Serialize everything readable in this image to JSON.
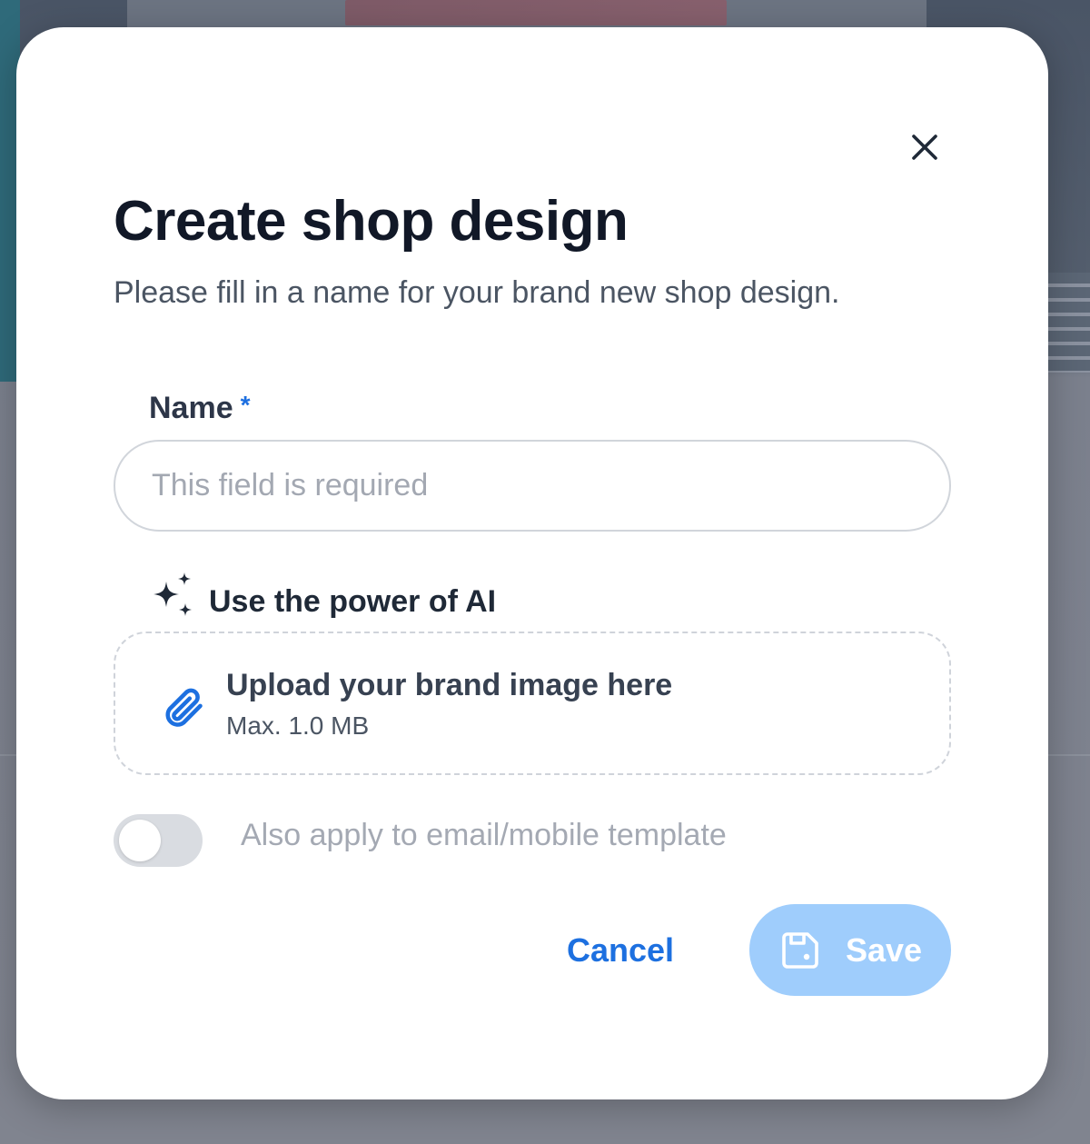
{
  "modal": {
    "title": "Create shop design",
    "subtitle": "Please fill in a name for your brand new shop design.",
    "close_icon": "close-icon"
  },
  "name_field": {
    "label": "Name",
    "required_marker": "*",
    "value": "",
    "placeholder": "This field is required"
  },
  "ai_section": {
    "icon": "sparkles-icon",
    "label": "Use the power of AI"
  },
  "upload": {
    "icon": "paperclip-icon",
    "title": "Upload your brand image here",
    "limit": "Max. 1.0 MB"
  },
  "toggle": {
    "label": "Also apply to email/mobile template",
    "checked": false
  },
  "actions": {
    "cancel_label": "Cancel",
    "save_label": "Save",
    "save_icon": "save-icon",
    "save_disabled": true
  },
  "colors": {
    "accent": "#1d70e0",
    "save_disabled_bg": "#9fcdfc",
    "title_text": "#111827"
  }
}
